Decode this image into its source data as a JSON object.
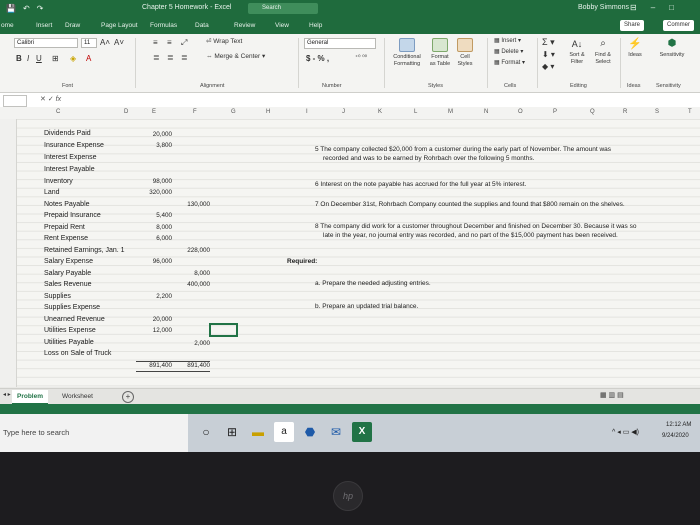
{
  "window": {
    "quick_access": [
      "💾",
      "↶",
      "↷"
    ],
    "title": "Chapter 5 Homework - Excel",
    "search": "Search",
    "user": "Bobby Simmons",
    "controls": [
      "⊟",
      "–",
      "□"
    ]
  },
  "ribbon_tabs": [
    "ome",
    "Insert",
    "Draw",
    "Page Layout",
    "Formulas",
    "Data",
    "Review",
    "View",
    "Help"
  ],
  "share_label": "Share",
  "comments_label": "Commer",
  "ribbon": {
    "font_name": "Calibri",
    "font_size": "11",
    "font_group": "Font",
    "wrap_text": "Wrap Text",
    "merge_center": "Merge & Center",
    "alignment_group": "Alignment",
    "number_format": "General",
    "number_format_symbols": "$ - % ,",
    "number_group": "Number",
    "conditional_formatting": "Conditional Formatting",
    "format_as_table": "Format as Table",
    "cell_styles": "Cell Styles",
    "styles_group": "Styles",
    "insert": "Insert",
    "delete": "Delete",
    "format": "Format",
    "cells_group": "Cells",
    "sort_filter": "Sort & Filter",
    "find_select": "Find & Select",
    "editing_group": "Editing",
    "ideas": "Ideas",
    "ideas_group": "Ideas",
    "sensitivity": "Sensitivity",
    "sensitivity_group": "Sensitivity"
  },
  "formula_bar": {
    "fx": "fx"
  },
  "columns": [
    "C",
    "D",
    "E",
    "F",
    "G",
    "H",
    "I",
    "J",
    "K",
    "L",
    "M",
    "N",
    "O",
    "P",
    "Q",
    "R",
    "S",
    "T"
  ],
  "accounts": [
    {
      "name": "Dividends Paid",
      "debit": "20,000",
      "credit": ""
    },
    {
      "name": "Insurance Expense",
      "debit": "3,800",
      "credit": ""
    },
    {
      "name": "Interest Expense",
      "debit": "",
      "credit": ""
    },
    {
      "name": "Interest Payable",
      "debit": "",
      "credit": ""
    },
    {
      "name": "Inventory",
      "debit": "98,000",
      "credit": ""
    },
    {
      "name": "Land",
      "debit": "320,000",
      "credit": ""
    },
    {
      "name": "Notes Payable",
      "debit": "",
      "credit": "130,000"
    },
    {
      "name": "Prepaid Insurance",
      "debit": "5,400",
      "credit": ""
    },
    {
      "name": "Prepaid Rent",
      "debit": "8,000",
      "credit": ""
    },
    {
      "name": "Rent Expense",
      "debit": "6,000",
      "credit": ""
    },
    {
      "name": "Retained Earnings, Jan. 1",
      "debit": "",
      "credit": "228,000"
    },
    {
      "name": "Salary Expense",
      "debit": "96,000",
      "credit": ""
    },
    {
      "name": "Salary Payable",
      "debit": "",
      "credit": "8,000"
    },
    {
      "name": "Sales Revenue",
      "debit": "",
      "credit": "400,000"
    },
    {
      "name": "Supplies",
      "debit": "2,200",
      "credit": ""
    },
    {
      "name": "Supplies Expense",
      "debit": "",
      "credit": ""
    },
    {
      "name": "Unearned Revenue",
      "debit": "20,000",
      "credit": ""
    },
    {
      "name": "Utilities Expense",
      "debit": "12,000",
      "credit": ""
    },
    {
      "name": "Utilities Payable",
      "debit": "",
      "credit": "2,000"
    },
    {
      "name": "Loss on Sale of Truck",
      "debit": "",
      "credit": ""
    }
  ],
  "totals": {
    "debit": "891,400",
    "credit": "891,400"
  },
  "notes": [
    "5 The company collected $20,000 from a customer during the early part of November. The amount was",
    "recorded and was to be earned by Rohrbach over the following 5 months.",
    "6 Interest on the note payable has accrued for the full year at 5% interest.",
    "7 On December 31st, Rohrbach Company counted the supplies and found that $800 remain on the shelves.",
    "8 The company did work for a customer throughout December and finished on December 30. Because it was so",
    "late in the year, no journal entry was recorded, and no part of the $15,000 payment has been received.",
    "Required:",
    "a.  Prepare the needed adjusting entries.",
    "b.  Prepare an updated trial balance."
  ],
  "sheet_tabs": [
    "Problem",
    "Worksheet"
  ],
  "add_sheet": "+",
  "taskbar": {
    "search_placeholder": "Type here to search",
    "apps": [
      "○",
      "⊞",
      "▬",
      "a",
      "⬣",
      "✉",
      "X"
    ],
    "tray": "^ ◂ ▭ ◀)",
    "time": "12:12 AM",
    "date": "9/24/2020"
  },
  "laptop_logo": "hp",
  "colors": {
    "accent": "#217346",
    "titlebar": "#1f6b3d"
  }
}
